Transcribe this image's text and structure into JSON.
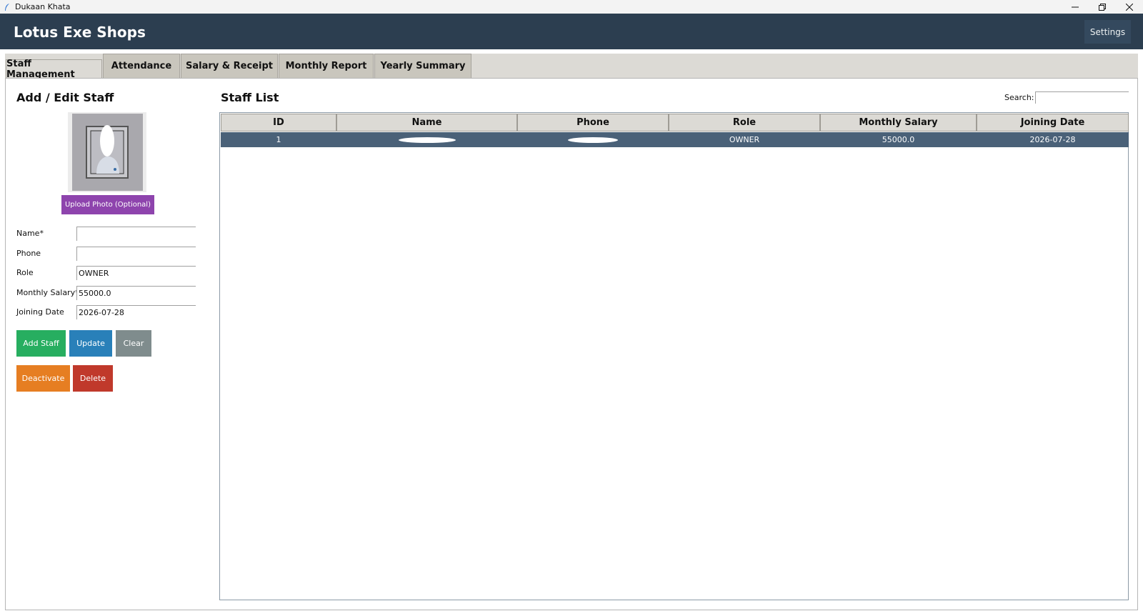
{
  "window": {
    "title": "Dukaan Khata",
    "controls": [
      "minimize",
      "restore",
      "close"
    ]
  },
  "header": {
    "brand": "Lotus Exe Shops",
    "settings_label": "Settings"
  },
  "tabs": [
    {
      "label": "Staff Management",
      "active": true
    },
    {
      "label": "Attendance",
      "active": false
    },
    {
      "label": "Salary & Receipt",
      "active": false
    },
    {
      "label": "Monthly Report",
      "active": false
    },
    {
      "label": "Yearly Summary",
      "active": false
    }
  ],
  "form": {
    "title": "Add / Edit Staff",
    "upload_label": "Upload Photo (Optional)",
    "fields": [
      {
        "label": "Name*",
        "value": ""
      },
      {
        "label": "Phone",
        "value": ""
      },
      {
        "label": "Role",
        "value": "OWNER"
      },
      {
        "label": "Monthly Salary*",
        "value": "55000.0"
      },
      {
        "label": "Joining Date",
        "value": "2026-07-28"
      }
    ],
    "buttons": {
      "add": "Add Staff",
      "update": "Update",
      "clear": "Clear",
      "deactivate": "Deactivate",
      "delete": "Delete"
    }
  },
  "list": {
    "title": "Staff List",
    "search_label": "Search:",
    "search_value": "",
    "columns": [
      "ID",
      "Name",
      "Phone",
      "Role",
      "Monthly Salary",
      "Joining Date"
    ],
    "rows": [
      {
        "id": "1",
        "name": "",
        "phone": "",
        "role": "OWNER",
        "salary": "55000.0",
        "joining": "2026-07-28",
        "selected": true
      }
    ]
  },
  "colors": {
    "header_bg": "#2c3e50",
    "upload": "#8e44ad",
    "add": "#27ae60",
    "update": "#2980b9",
    "clear": "#7f8c8d",
    "deactivate": "#e67e22",
    "delete": "#c0392b",
    "selected_row": "#4a6178"
  }
}
